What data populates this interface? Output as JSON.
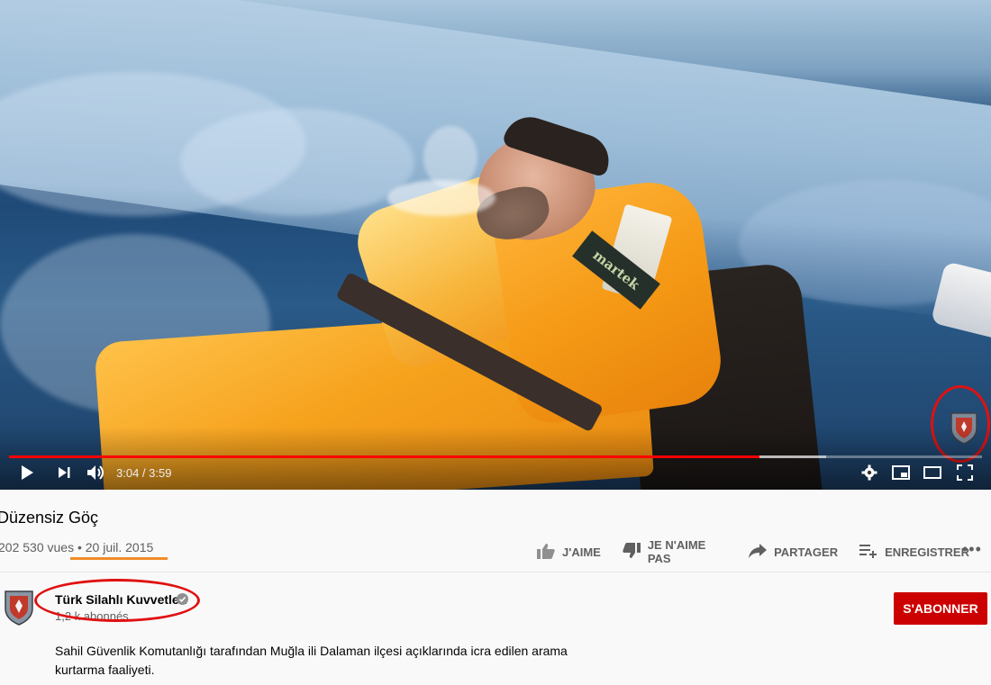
{
  "player": {
    "time_display": "3:04 / 3:59",
    "progress_fraction": 0.771,
    "buffered_fraction": 0.84,
    "brand_text": "martek"
  },
  "video": {
    "title": "Düzensiz Göç",
    "views": "202 530 vues",
    "separator": "•",
    "date": "20 juil. 2015"
  },
  "actions": {
    "like": "J'AIME",
    "dislike": "JE N'AIME PAS",
    "share": "PARTAGER",
    "save": "ENREGISTRER",
    "more": "•••"
  },
  "channel": {
    "name": "Türk Silahlı Kuvvetleri",
    "subscribers": "1,2 k abonnés",
    "subscribe_label": "S'ABONNER"
  },
  "description": "Sahil Güvenlik Komutanlığı tarafından Muğla ili Dalaman ilçesi açıklarında icra edilen arama kurtarma faaliyeti.",
  "colors": {
    "accent_red": "#cc0000",
    "progress_red": "#ff0000",
    "annotation_red": "#e01111",
    "annotation_orange": "#f28c28"
  },
  "icons": [
    "play-icon",
    "next-icon",
    "volume-icon",
    "settings-icon",
    "miniplayer-icon",
    "theater-icon",
    "fullscreen-icon",
    "like-icon",
    "dislike-icon",
    "share-icon",
    "save-playlist-icon",
    "verified-icon"
  ]
}
